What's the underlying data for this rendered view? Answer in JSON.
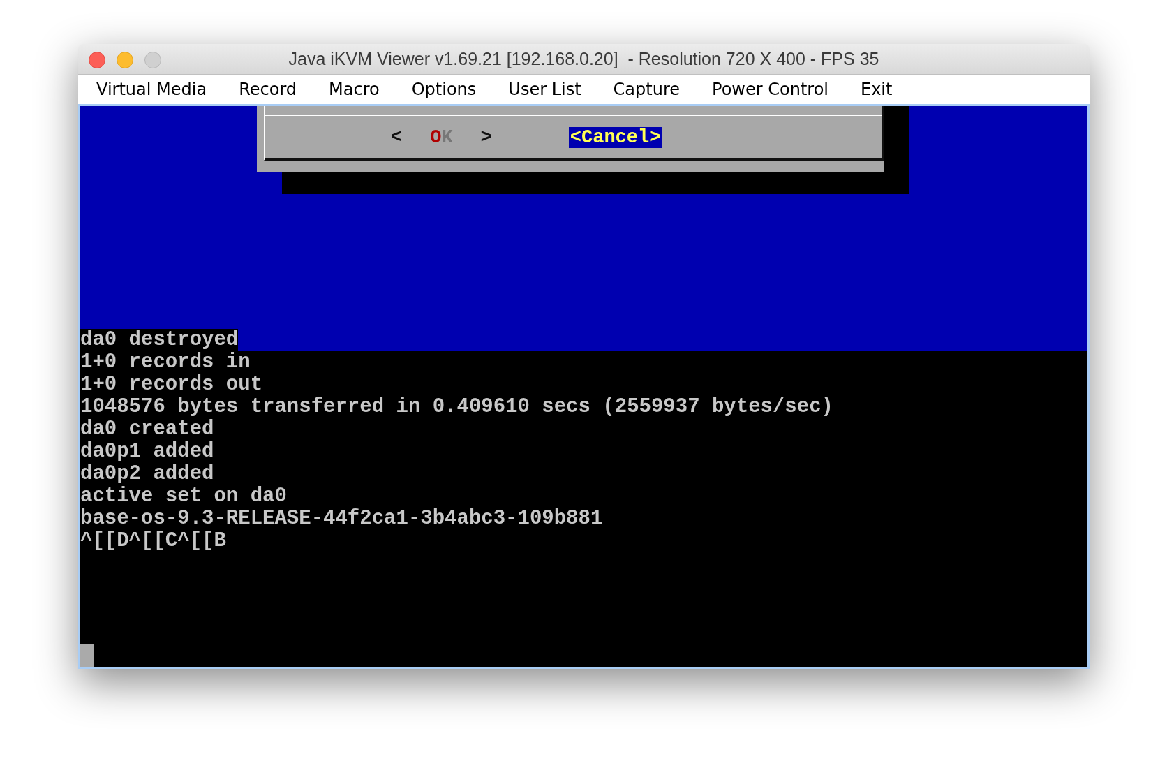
{
  "window": {
    "title": "Java iKVM Viewer v1.69.21 [192.168.0.20]  - Resolution 720 X 400 - FPS 35"
  },
  "menu": [
    "Virtual Media",
    "Record",
    "Macro",
    "Options",
    "User List",
    "Capture",
    "Power Control",
    "Exit"
  ],
  "dialog": {
    "buttons": [
      {
        "open": "<",
        "label": "OK",
        "close": ">",
        "selected": false
      },
      {
        "open": "<",
        "label": "Cancel",
        "close": ">",
        "selected": true
      }
    ]
  },
  "terminal": {
    "lines": [
      {
        "text": "da0 destroyed",
        "backdrop": true
      },
      {
        "text": "1+0 records in",
        "backdrop": false
      },
      {
        "text": "1+0 records out",
        "backdrop": false
      },
      {
        "text": "1048576 bytes transferred in 0.409610 secs (2559937 bytes/sec)",
        "backdrop": false
      },
      {
        "text": "da0 created",
        "backdrop": false
      },
      {
        "text": "da0p1 added",
        "backdrop": false
      },
      {
        "text": "da0p2 added",
        "backdrop": false
      },
      {
        "text": "active set on da0",
        "backdrop": false
      },
      {
        "text": "base-os-9.3-RELEASE-44f2ca1-3b4abc3-109b881",
        "backdrop": false
      },
      {
        "text": "^[[D^[[C^[[B",
        "backdrop": false
      }
    ]
  }
}
